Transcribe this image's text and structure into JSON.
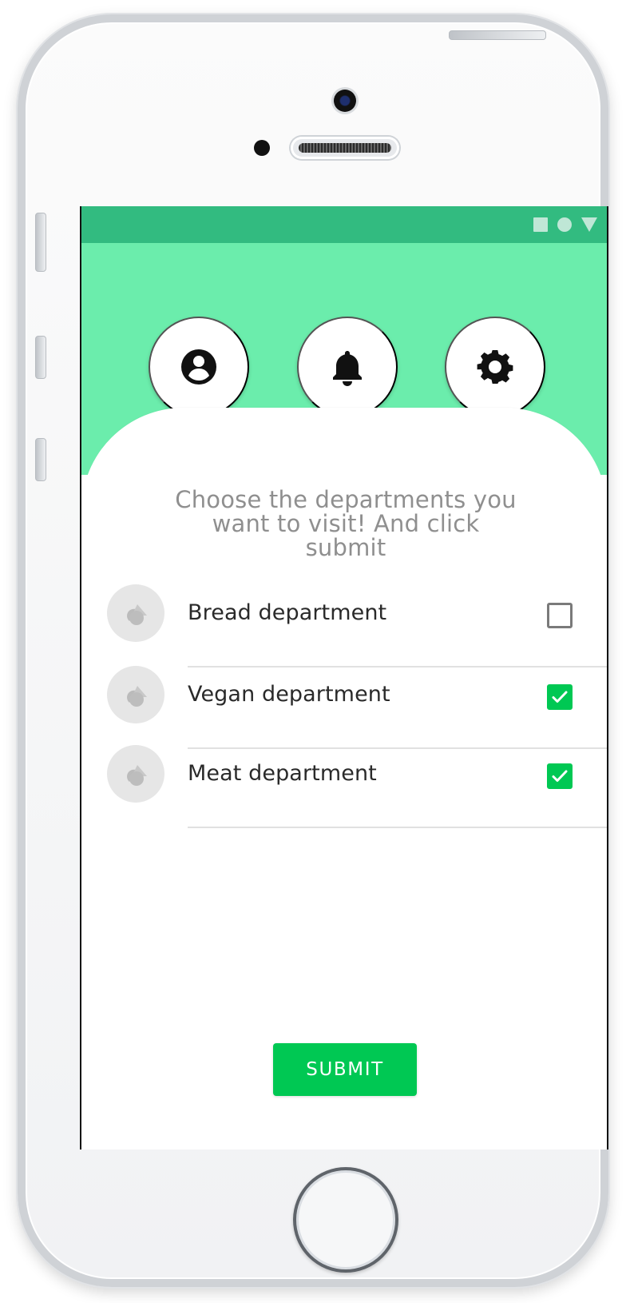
{
  "app": {
    "title": "Choose the departments you want to visit! And click submit"
  },
  "status_bar": {
    "icons": [
      "square-status-icon",
      "circle-status-icon",
      "triangle-status-icon"
    ],
    "color": "#32bb80",
    "icon_color": "#bfe7d6"
  },
  "header": {
    "background": "#6bedac",
    "buttons": [
      {
        "icon": "profile-icon"
      },
      {
        "icon": "bell-icon"
      },
      {
        "icon": "gear-icon"
      }
    ]
  },
  "departments": [
    {
      "label": "Bread department",
      "checked": false,
      "icon": "department-placeholder-icon"
    },
    {
      "label": "Vegan department",
      "checked": true,
      "icon": "department-placeholder-icon"
    },
    {
      "label": "Meat department",
      "checked": true,
      "icon": "department-placeholder-icon"
    }
  ],
  "submit": {
    "label": "SUBMIT",
    "color": "#00c853"
  },
  "theme": {
    "checkbox_checked": "#00c853",
    "checkbox_unchecked": "#7a7a7a",
    "headline_color": "#8f8f8f"
  }
}
